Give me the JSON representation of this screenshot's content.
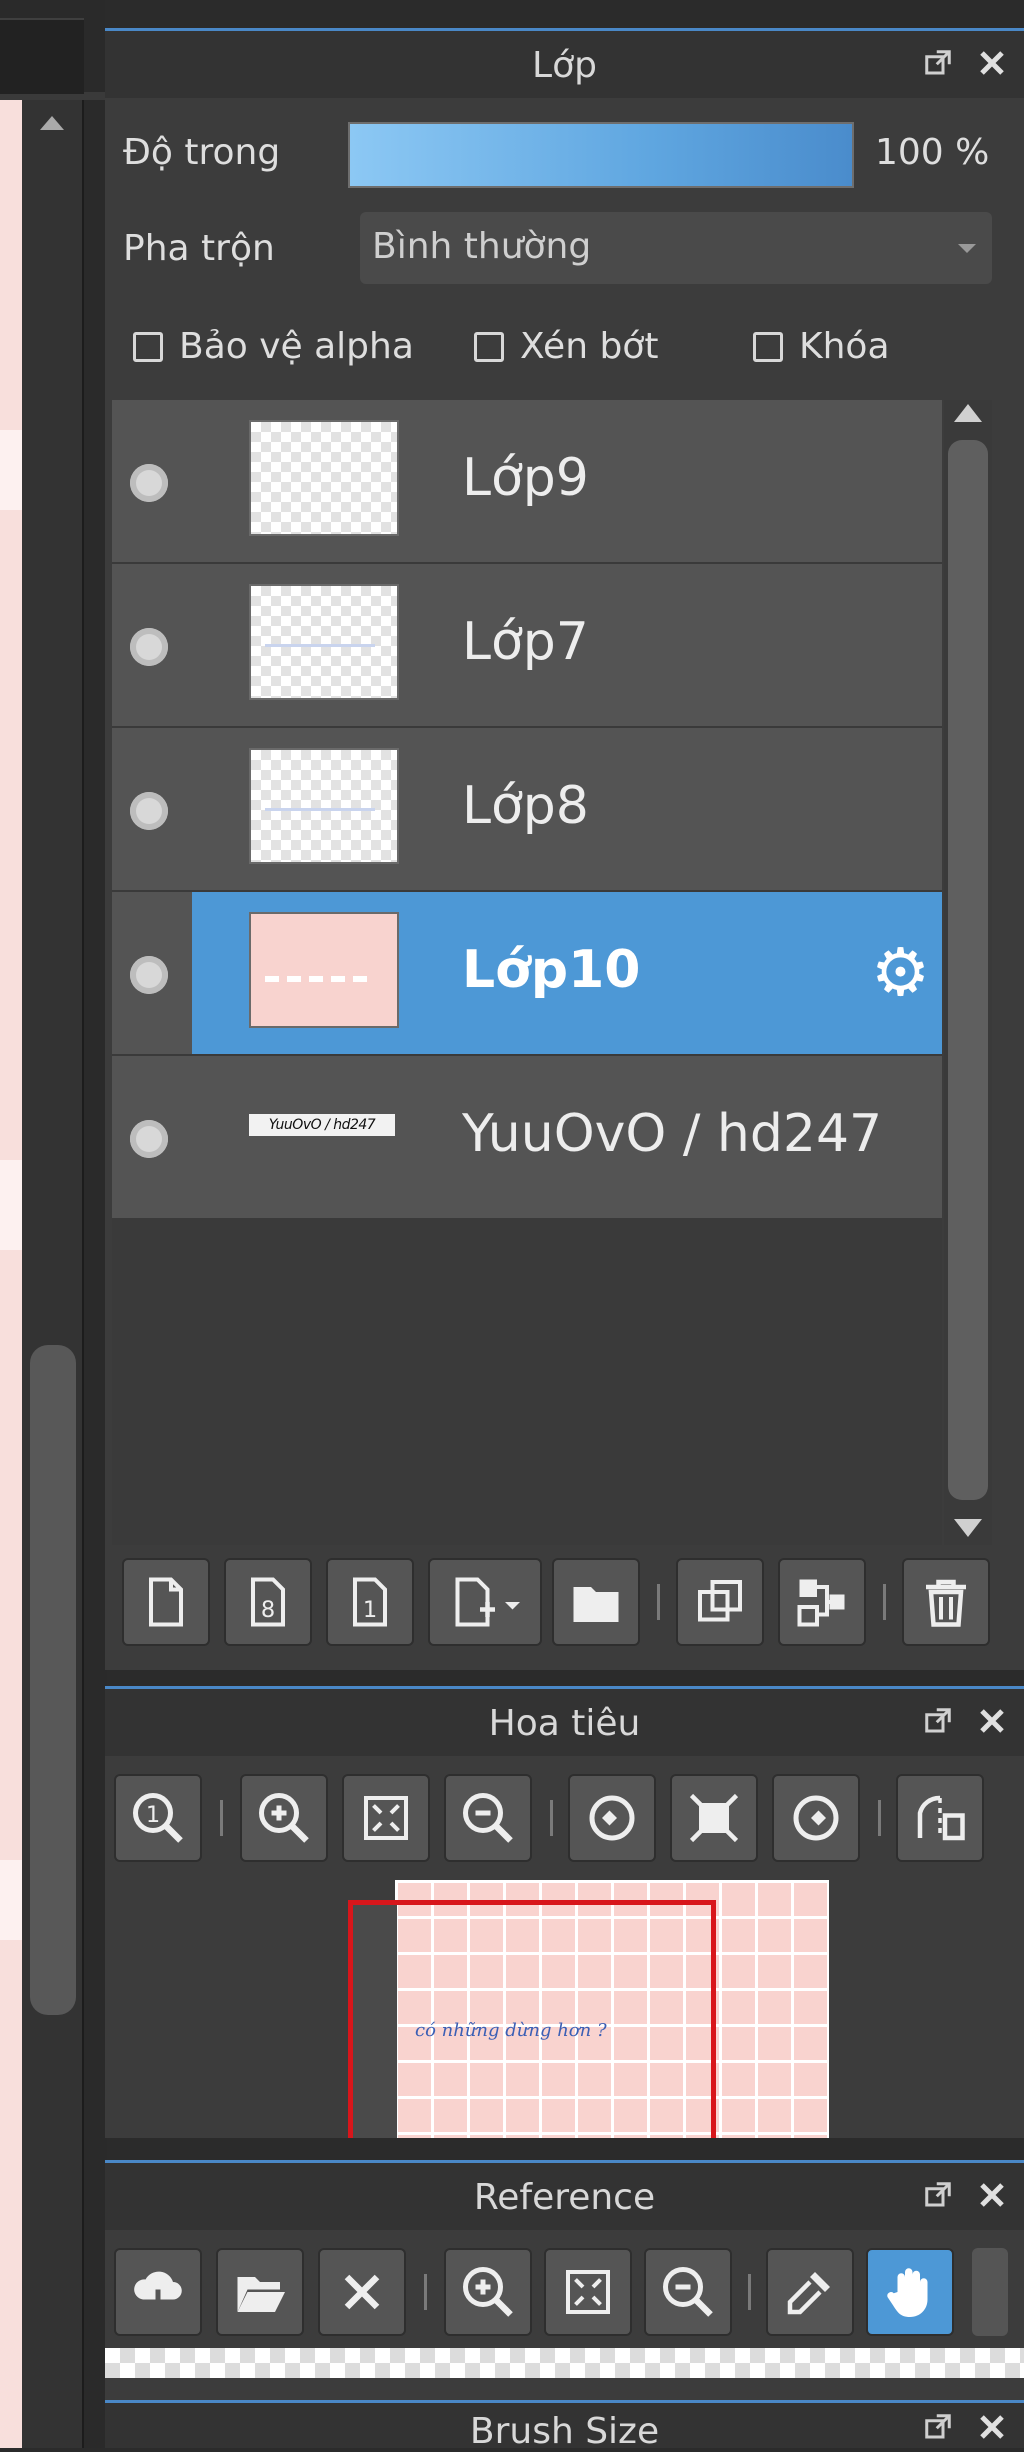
{
  "layer_panel": {
    "title": "Lớp",
    "opacity_label": "Độ trong",
    "opacity_value": "100 %",
    "opacity_fraction": 1.0,
    "blend_label": "Pha trộn",
    "blend_value": "Bình thường",
    "checkboxes": [
      {
        "label": "Bảo vệ alpha",
        "checked": false
      },
      {
        "label": "Xén bớt",
        "checked": false
      },
      {
        "label": "Khóa",
        "checked": false
      }
    ],
    "layers": [
      {
        "name": "Lớp9",
        "visible": true,
        "selected": false,
        "thumb": "transparent"
      },
      {
        "name": "Lớp7",
        "visible": true,
        "selected": false,
        "thumb": "transparent"
      },
      {
        "name": "Lớp8",
        "visible": true,
        "selected": false,
        "thumb": "transparent"
      },
      {
        "name": "Lớp10",
        "visible": true,
        "selected": true,
        "thumb": "pink"
      },
      {
        "name": "YuuOvO / hd247",
        "visible": true,
        "selected": false,
        "thumb": "text",
        "thumb_text": "YuuOvO / hd247"
      }
    ],
    "toolbar": [
      "new-layer-icon",
      "new-8bit-layer-icon",
      "new-1bit-layer-icon",
      "add-layer-menu-icon",
      "new-folder-icon",
      "duplicate-layer-icon",
      "merge-down-icon",
      "delete-layer-icon"
    ]
  },
  "navigator_panel": {
    "title": "Hoa tiêu",
    "toolbar": [
      "zoom-actual-icon",
      "zoom-in-icon",
      "fit-window-icon",
      "zoom-out-icon",
      "rotate-left-icon",
      "reset-view-icon",
      "rotate-right-icon",
      "flip-horizontal-icon"
    ],
    "preview_text": "có những dừng hơn ?"
  },
  "reference_panel": {
    "title": "Reference",
    "toolbar": [
      "open-cloud-icon",
      "open-folder-icon",
      "close-icon",
      "zoom-in-icon",
      "fit-window-icon",
      "zoom-out-icon",
      "eyedropper-icon",
      "hand-icon"
    ],
    "active_tool": "hand-icon"
  },
  "brush_size_panel": {
    "title": "Brush Size"
  },
  "colors": {
    "accent": "#4d98d6",
    "panel_bg": "#3c3c3c",
    "header_bg": "#333333",
    "canvas_pink": "#f8dfdc",
    "nav_frame_red": "#d8161b"
  }
}
